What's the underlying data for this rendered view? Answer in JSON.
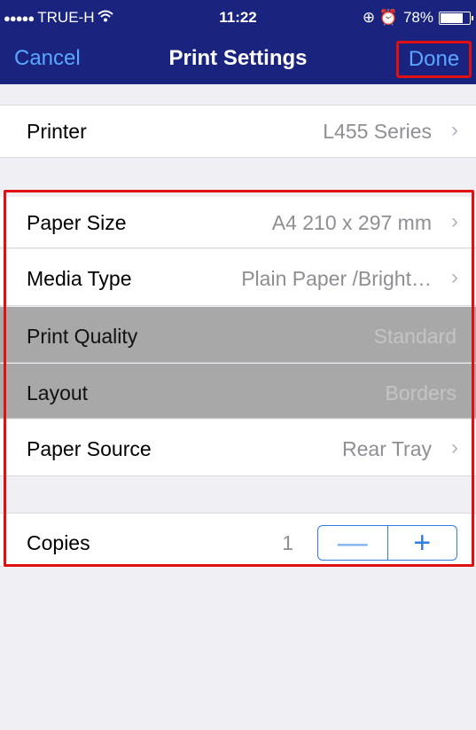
{
  "status_bar": {
    "carrier": "TRUE-H",
    "signal": "●●●●●",
    "wifi_icon": "wifi-icon",
    "time": "11:22",
    "icons": "⊕ ⏰",
    "battery": "78%",
    "battery_level": 0.78
  },
  "nav": {
    "cancel": "Cancel",
    "title": "Print Settings",
    "done": "Done"
  },
  "printer": {
    "label": "Printer",
    "value": "L455 Series"
  },
  "settings": {
    "paper_size": {
      "label": "Paper Size",
      "value": "A4 210 x 297 mm"
    },
    "media_type": {
      "label": "Media Type",
      "value": "Plain Paper /Bright…"
    },
    "print_quality": {
      "label": "Print Quality",
      "value": "Standard"
    },
    "layout": {
      "label": "Layout",
      "value": "Borders"
    },
    "paper_source": {
      "label": "Paper Source",
      "value": "Rear Tray"
    }
  },
  "copies": {
    "label": "Copies",
    "value": "1",
    "minus": "—",
    "plus": "+"
  },
  "chevron": "›",
  "colors": {
    "nav_bg": "#1a237e",
    "accent": "#2f7de1",
    "highlight": "#e01010",
    "disabled_row": "#a8a8a8"
  }
}
